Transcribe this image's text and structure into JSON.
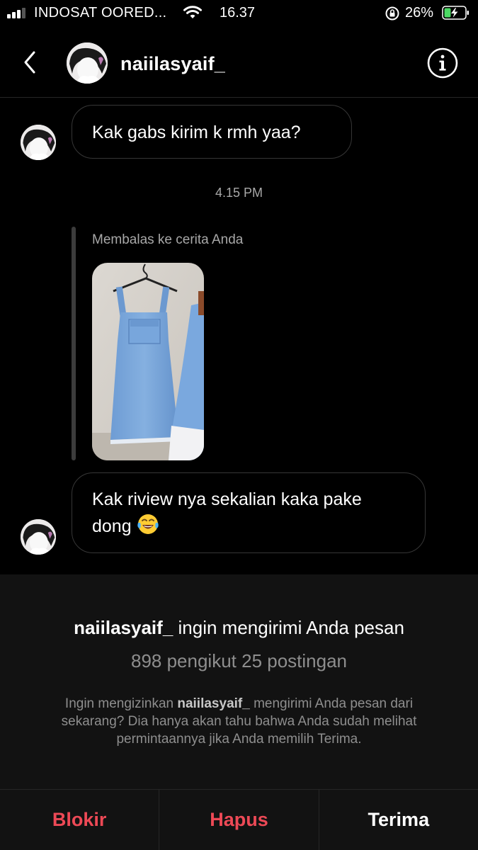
{
  "status_bar": {
    "carrier": "INDOSAT OORED...",
    "time": "16.37",
    "battery": "26%",
    "signal_bars_filled": 3,
    "signal_bars_total": 4,
    "icons": [
      "signal-icon",
      "wifi-icon",
      "rotation-lock-icon",
      "battery-charging-icon"
    ]
  },
  "header": {
    "username": "naiilasyaif_",
    "icons": [
      "back-icon",
      "avatar",
      "info-icon"
    ]
  },
  "messages": [
    {
      "text": "Kak gabs kirim k rmh yaa?"
    },
    {
      "timestamp": "4.15 PM"
    },
    {
      "reply_label": "Membalas ke cerita Anda"
    },
    {
      "text": "Kak riview nya sekalian kaka pake dong",
      "emoji": "face-with-tears-of-joy"
    }
  ],
  "request": {
    "title_name": "naiilasyaif_",
    "title_rest": " ingin mengirimi Anda pesan",
    "stats": "898 pengikut 25 postingan",
    "desc_before": "Ingin mengizinkan ",
    "desc_name": "naiilasyaif_",
    "desc_after": " mengirimi Anda pesan dari sekarang? Dia hanya akan tahu bahwa Anda sudah melihat permintaannya jika Anda memilih Terima."
  },
  "actions": {
    "block": "Blokir",
    "delete": "Hapus",
    "accept": "Terima"
  },
  "colors": {
    "background": "#000000",
    "panel": "#121212",
    "danger": "#ed4956",
    "secondary_text": "#8e8e8e",
    "battery_charging": "#4cd964"
  }
}
